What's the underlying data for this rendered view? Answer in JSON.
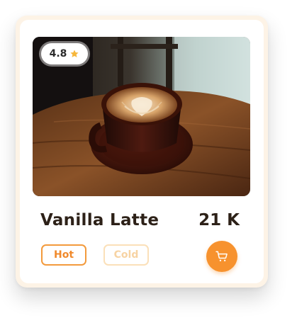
{
  "product": {
    "name": "Vanilla Latte",
    "price": "21 K",
    "rating": "4.8",
    "image_alt_icon": "coffee-cup-photo"
  },
  "options": {
    "hot_label": "Hot",
    "cold_label": "Cold",
    "selected": "Hot"
  },
  "actions": {
    "cart_icon": "shopping-cart-icon"
  },
  "colors": {
    "accent": "#f7922e",
    "accent_light": "#fbe0b9",
    "text_dark": "#2d2118",
    "star": "#f6b73c",
    "card_frame": "#fdf3e6"
  }
}
